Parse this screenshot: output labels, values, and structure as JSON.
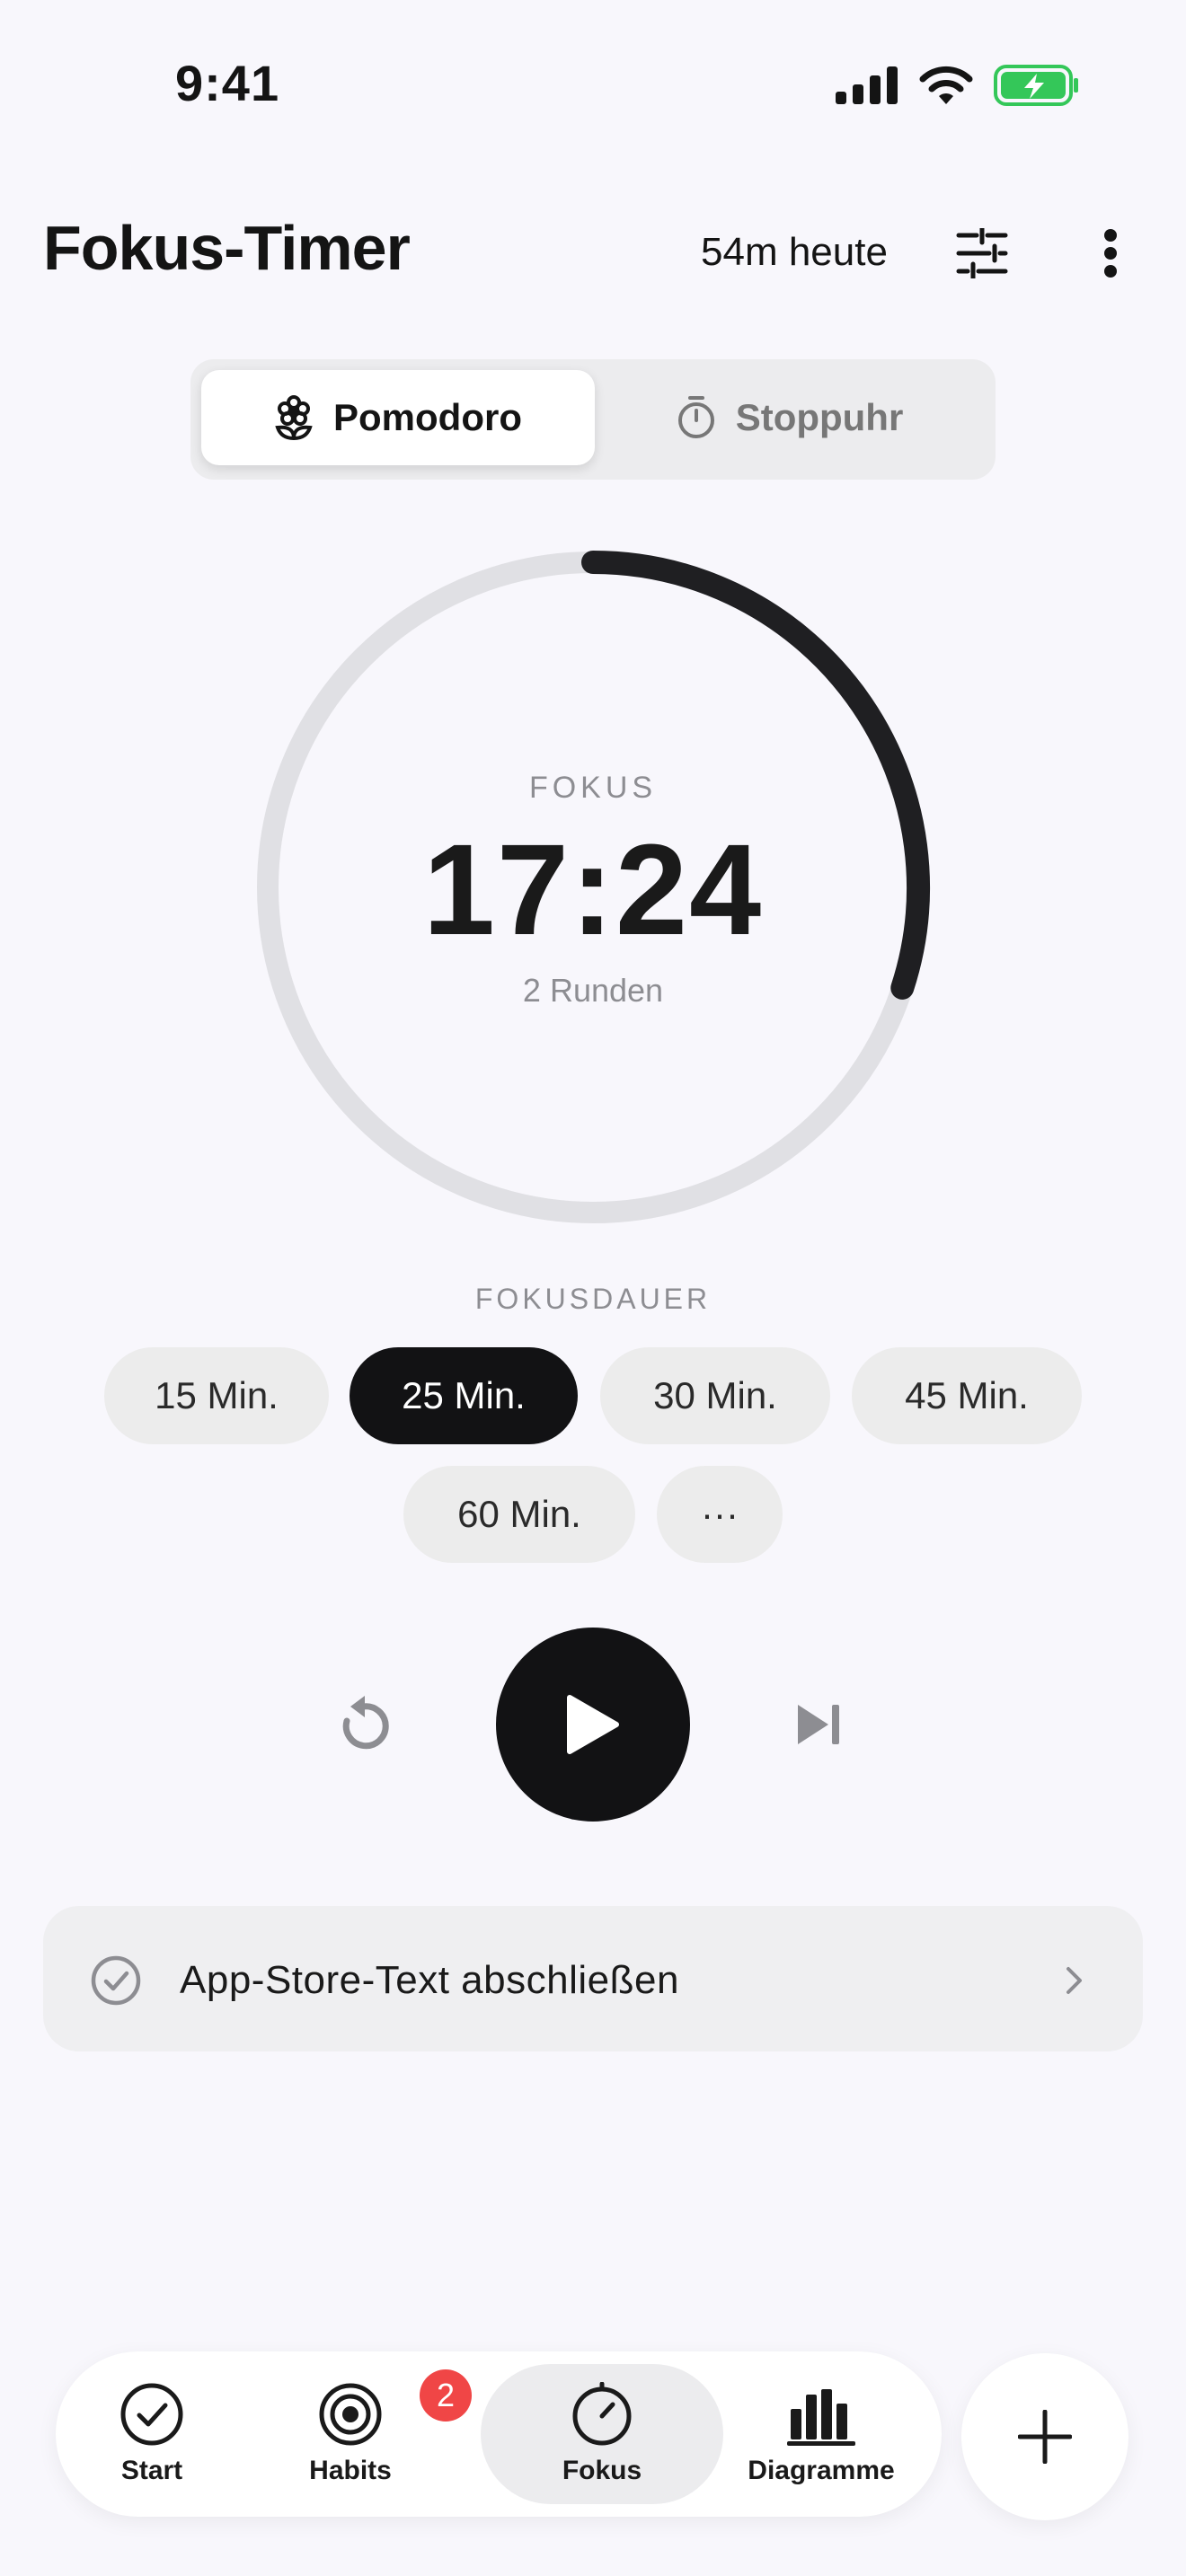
{
  "status_bar": {
    "time": "9:41"
  },
  "header": {
    "title": "Fokus-Timer",
    "today_total": "54m heute"
  },
  "mode_switch": {
    "options": [
      {
        "label": "Pomodoro",
        "icon": "flower-icon",
        "selected": true
      },
      {
        "label": "Stoppuhr",
        "icon": "stopwatch-icon",
        "selected": false
      }
    ]
  },
  "timer": {
    "phase": "FOKUS",
    "remaining": "17:24",
    "rounds": "2 Runden",
    "progress": 0.3
  },
  "duration": {
    "label": "FOKUSDAUER",
    "options": [
      "15 Min.",
      "25 Min.",
      "30 Min.",
      "45 Min.",
      "60 Min.",
      "···"
    ],
    "selected": "25 Min."
  },
  "task": {
    "label": "App-Store-Text abschließen"
  },
  "nav": {
    "items": [
      {
        "label": "Start",
        "icon": "check-circle-icon"
      },
      {
        "label": "Habits",
        "icon": "target-icon",
        "badge": "2"
      },
      {
        "label": "Fokus",
        "icon": "timer-icon",
        "active": true
      },
      {
        "label": "Diagramme",
        "icon": "bar-chart-icon"
      }
    ]
  },
  "colors": {
    "background": "#F8F7FC",
    "accent": "#121214",
    "ring_track": "#E0E0E4",
    "badge": "#F04646",
    "battery": "#34C759"
  }
}
